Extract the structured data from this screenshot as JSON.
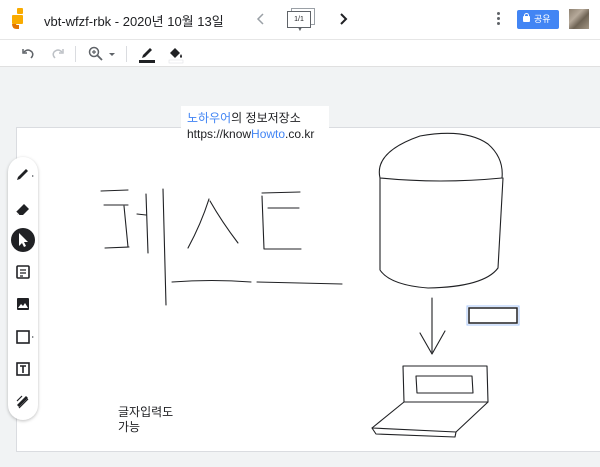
{
  "header": {
    "title": "vbt-wfzf-rbk - 2020년 10월 13일",
    "frame_counter": "1/1",
    "share_label": "공유"
  },
  "toolbar": {
    "items": [
      "undo-icon",
      "redo-icon",
      "zoom-icon",
      "zoom-dropdown-icon",
      "pen-color-icon",
      "fill-color-icon"
    ]
  },
  "sidebar": {
    "tools": [
      "pen",
      "eraser",
      "select",
      "sticky-note",
      "image",
      "shape",
      "text-box",
      "laser"
    ],
    "active_tool": "select"
  },
  "canvas": {
    "label": {
      "part1_colored": "노하우어",
      "part1_rest": "의 정보저장소",
      "url_prefix": "https://know",
      "url_colored": "Howto",
      "url_suffix": ".co.kr"
    },
    "note_line1": "글자입력도",
    "note_line2": "가능",
    "accent_color": "#4285f4",
    "share_color": "#4285f4"
  }
}
